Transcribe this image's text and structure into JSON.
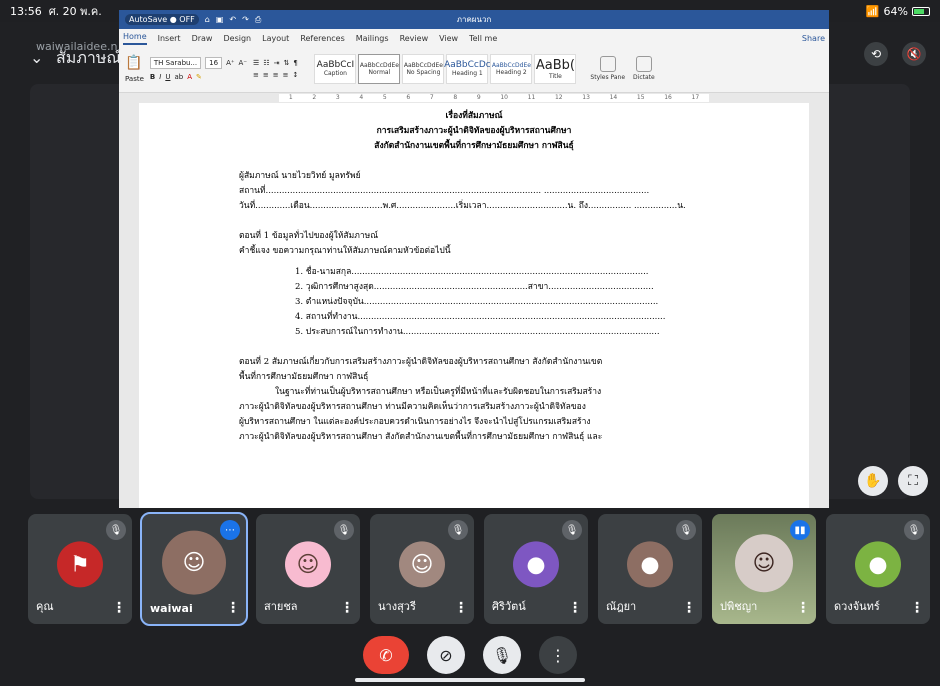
{
  "status": {
    "time": "13:56",
    "date": "ศ. 20 พ.ค.",
    "battery": "64%",
    "wifi_icon": "wifi-icon"
  },
  "meet": {
    "title": "สัมภาษณ์",
    "subname": "waiwailaidee.n"
  },
  "word": {
    "autosave": "AutoSave ● OFF",
    "doc_title": "ภาคผนวก",
    "tabs": [
      "Home",
      "Insert",
      "Draw",
      "Design",
      "Layout",
      "References",
      "Mailings",
      "Review",
      "View",
      "Tell me"
    ],
    "share": "Share",
    "font": "TH Sarabu...",
    "size": "16",
    "paste": "Paste",
    "styles": [
      {
        "sample": "AaBbCcI",
        "name": "Caption"
      },
      {
        "sample": "AaBbCcDdEe",
        "name": "Normal"
      },
      {
        "sample": "AaBbCcDdEe",
        "name": "No Spacing"
      },
      {
        "sample": "AaBbCcDc",
        "name": "Heading 1"
      },
      {
        "sample": "AaBbCcDdEe",
        "name": "Heading 2"
      },
      {
        "sample": "AaBb(",
        "name": "Title"
      }
    ],
    "styles_pane": "Styles Pane",
    "dictate": "Dictate"
  },
  "doc": {
    "h1": "เรื่องที่สัมภาษณ์",
    "h2": "การเสริมสร้างภาวะผู้นำดิจิทัลของผู้บริหารสถานศึกษา",
    "h3": "สังกัดสำนักงานเขตพื้นที่การศึกษามัธยมศึกษา กาฬสินธุ์",
    "interviewer": "ผู้สัมภาษณ์   นายไวยวิทย์  มูลทรัพย์",
    "place": "สถานที่......................................................................................................  .......................................",
    "date_line": "วันที่.............เดือน...........................พ.ศ......................เริ่มเวลา..............................น. ถึง................ ................น.",
    "part1": "ตอนที่ 1  ข้อมูลทั่วไปของผู้ให้สัมภาษณ์",
    "instruction": "คำชี้แจง  ขอความกรุณาท่านให้สัมภาษณ์ตามหัวข้อต่อไปนี้",
    "items": [
      "1. ชื่อ-นามสกุล..............................................................................................................",
      "2. วุฒิการศึกษาสูงสุด.........................................................สาขา.......................................",
      "3. ตำแหน่งปัจจุบัน.............................................................................................................",
      "4. สถานที่ทำงาน..................................................................................................................",
      "5. ประสบการณ์ในการทำงาน..............................................................................................."
    ],
    "part2": "ตอนที่ 2  สัมภาษณ์เกี่ยวกับการเสริมสร้างภาวะผู้นำดิจิทัลของผู้บริหารสถานศึกษา สังกัดสำนักงานเขต",
    "part2b": "พื้นที่การศึกษามัธยมศึกษา กาฬสินธุ์",
    "p1": "ในฐานะที่ท่านเป็นผู้บริหารสถานศึกษา หรือเป็นครูที่มีหน้าที่และรับผิดชอบในการเสริมสร้าง",
    "p2": "ภาวะผู้นำดิจิทัลของผู้บริหารสถานศึกษา ท่านมีความคิดเห็นว่าการเสริมสร้างภาวะผู้นำดิจิทัลของ",
    "p3": "ผู้บริหารสถานศึกษา ในแต่ละองค์ประกอบควรดำเนินการอย่างไร จึงจะนำไปสู่โปรแกรมเสริมสร้าง",
    "p4": "ภาวะผู้นำดิจิทัลของผู้บริหารสถานศึกษา สังกัดสำนักงานเขตพื้นที่การศึกษามัธยมศึกษา กาฬสินธุ์ และ"
  },
  "participants": [
    {
      "name": "คุณ",
      "color": "#c62828",
      "mic": "muted"
    },
    {
      "name": "waiwai",
      "color": "#8d6e63",
      "mic": "more"
    },
    {
      "name": "สายชล",
      "color": "#f8bbd0",
      "mic": "muted"
    },
    {
      "name": "นางสุวรี",
      "color": "#a1887f",
      "mic": "muted"
    },
    {
      "name": "ศิริวัตน์",
      "color": "#7e57c2",
      "mic": "muted"
    },
    {
      "name": "ณัฎยา",
      "color": "#8d6e63",
      "mic": "muted"
    },
    {
      "name": "ปพิชญา",
      "color": "#6b7a5a",
      "mic": "speaking"
    },
    {
      "name": "ดวงจันทร์",
      "color": "#7cb342",
      "mic": "muted"
    }
  ]
}
